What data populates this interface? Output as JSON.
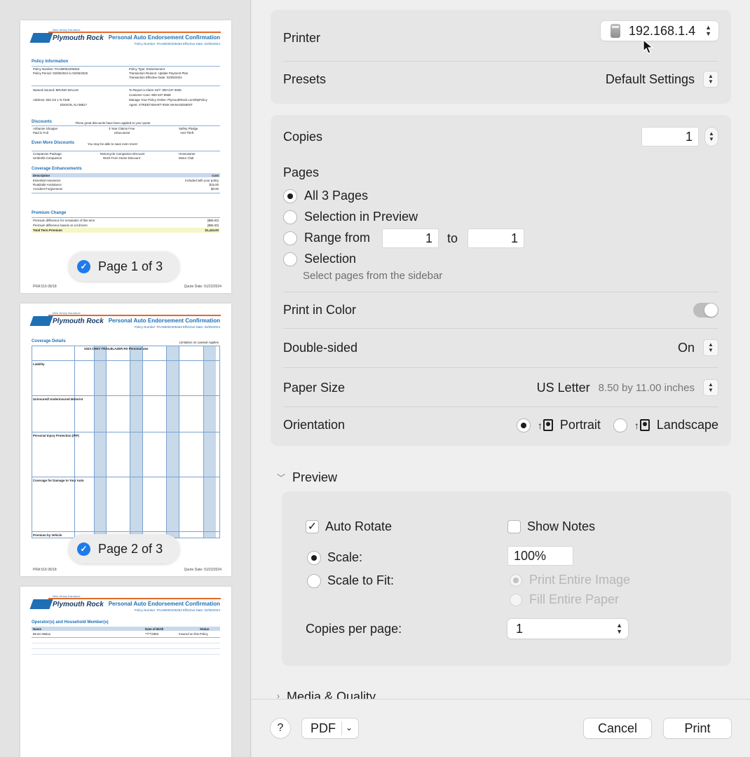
{
  "sidebar": {
    "thumbnails": [
      {
        "title": "Personal Auto Endorsement Confirmation",
        "subtitle": "Policy Number: PAA80002205463    Effective Date: 02/05/2024",
        "logo_text": "Plymouth Rock",
        "logo_sub": "New Jersey Insurance",
        "sections": [
          "Policy Information",
          "Discounts",
          "Even More Discounts",
          "Coverage Enhancements",
          "Premium Change"
        ],
        "lines": {
          "policy_number": "Policy Number:   PAA80002205463",
          "policy_period": "Policy Period:   02/05/2024  to 02/05/2025",
          "named_insured": "Named Insured:   BRUNO WALUS",
          "address": "Address:   652 US 1 N #108",
          "address2": "EDISON, NJ 08817",
          "policy_type": "Policy Type:   Endorsement",
          "transaction_reason": "Transaction Reason:   Update Payment Plan",
          "effective": "Transaction Effective Date:   02/05/2024",
          "claim": "To Report a Claim 24/7:   800-437-3535",
          "customer_care": "Customer Care:   800-437-5558",
          "manage": "Manage Your Policy Online:   PlymouthRock.com/MyPolicy",
          "agent": "Agent:   STREETSMART RISK MANAGEMENT",
          "disc_intro": "These great discounts have been applied to your quote:",
          "disc_1": "Airbanne Shopper",
          "disc_2": "3 Year Claims Free",
          "disc_3": "Safety Pledge",
          "disc_4": "Paid in Full",
          "disc_5": "eDocument",
          "disc_6": "Anti-Theft",
          "more_intro": "You may be able to save even more!",
          "more_1": "Companion Package",
          "more_2": "Motorcycle Companion Discount",
          "more_3": "Homeowner",
          "more_4": "Umbrella Companion",
          "more_5": "Work From Home Discount",
          "more_6": "Motor Club",
          "cov_desc": "Description",
          "cov_cost": "Cost",
          "cov_1": "Essential Assurance",
          "cov_1v": "Included with your policy",
          "cov_2": "Roadside Assistance",
          "cov_2v": "$15.00",
          "cov_3": "Accident Forgiveness",
          "cov_3v": "$0.00",
          "prem_1": "Premium difference for remainder of this term",
          "prem_1v": "($95.00)",
          "prem_2": "Premium difference based on a full term",
          "prem_2v": "($95.00)",
          "prem_total": "Total Term Premium",
          "prem_total_v": "$1,434.00"
        },
        "footer_left": "PRA 516 06/18",
        "footer_right": "Quote Date: 01/22/2024",
        "pill_label": "Page 1 of 3"
      },
      {
        "title": "Personal Auto Endorsement Confirmation",
        "subtitle": "Policy Number: PAA80002205463    Effective Date: 02/05/2024",
        "logo_text": "Plymouth Rock",
        "logo_sub": "New Jersey Insurance",
        "section": "Coverage Details",
        "section_right": "Limitation on Lawsuit Applies",
        "vehicle": "2023 CHEV TRAILBLAZER RS Personal Use",
        "rows": [
          "Liability",
          "Uninsured/ Underinsured Motorist",
          "Personal Injury Protection (PIP)",
          "Coverage for Damage to Your Auto",
          "Premium by Vehicle"
        ],
        "footer_left": "PRA 516 06/18",
        "footer_right": "Quote Date: 01/22/2024",
        "pill_label": "Page 2 of 3"
      },
      {
        "title": "Personal Auto Endorsement Confirmation",
        "subtitle": "Policy Number: PAA80002205463    Effective Date: 02/05/2024",
        "logo_text": "Plymouth Rock",
        "logo_sub": "New Jersey Insurance",
        "section": "Operator(s) and Household Member(s)",
        "col_name": "Name",
        "col_dob": "Date of Birth",
        "col_status": "Status",
        "driver_name": "Bruno Walus",
        "driver_dob": "**/**/1993",
        "driver_status": "Insured on this Policy"
      }
    ]
  },
  "print": {
    "printer_label": "Printer",
    "printer_value": "192.168.1.4",
    "presets_label": "Presets",
    "presets_value": "Default Settings",
    "copies_label": "Copies",
    "copies_value": "1",
    "pages_label": "Pages",
    "pages_options": [
      "All 3 Pages",
      "Selection in Preview",
      "Range from",
      "Selection"
    ],
    "range_from": "1",
    "range_to_label": "to",
    "range_to": "1",
    "selection_hint": "Select pages from the sidebar",
    "color_label": "Print in Color",
    "double_sided_label": "Double-sided",
    "double_sided_value": "On",
    "paper_size_label": "Paper Size",
    "paper_size_value": "US Letter",
    "paper_size_detail": "8.50 by 11.00 inches",
    "orientation_label": "Orientation",
    "portrait_label": "Portrait",
    "landscape_label": "Landscape"
  },
  "preview": {
    "section_label": "Preview",
    "auto_rotate": "Auto Rotate",
    "show_notes": "Show Notes",
    "scale_label": "Scale:",
    "scale_value": "100%",
    "scale_to_fit": "Scale to Fit:",
    "print_entire_image": "Print Entire Image",
    "fill_entire_paper": "Fill Entire Paper",
    "copies_per_page_label": "Copies per page:",
    "copies_per_page_value": "1"
  },
  "media_section": "Media & Quality",
  "footer": {
    "help": "?",
    "pdf": "PDF",
    "cancel": "Cancel",
    "print": "Print"
  }
}
